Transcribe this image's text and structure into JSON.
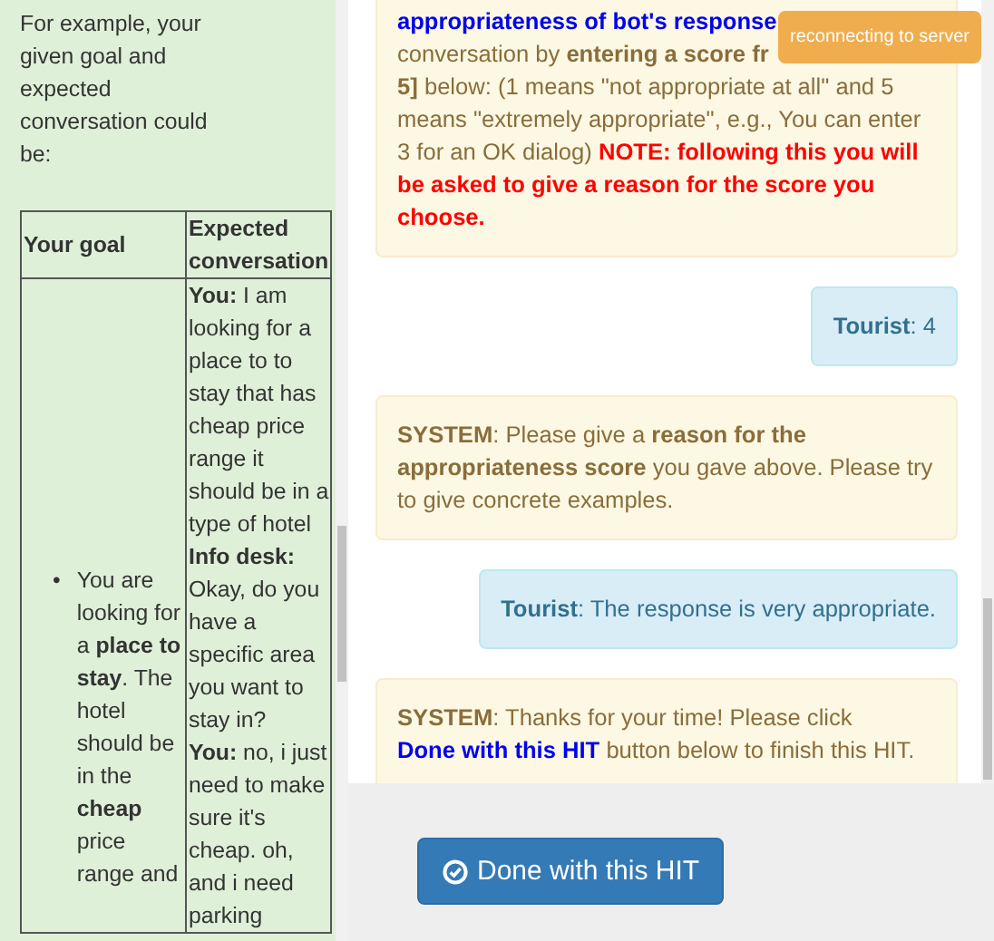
{
  "instructions": {
    "intro": "For example, your given goal and expected conversation could be:",
    "table": {
      "columns": [
        "Your goal",
        "Expected conversation"
      ],
      "bullet": "•",
      "goal": "You are looking for a **place to stay**. The hotel should be in the **cheap** price range and",
      "conversation": [
        "**You:** I am looking for a place to to stay that has cheap price range it should be in a type of hotel",
        "**Info desk:** Okay, do you have a specific area you want to stay in?",
        "**You:** no, i just need to make sure it's cheap. oh, and i need parking"
      ]
    }
  },
  "chat": {
    "messages": [
      {
        "kind": "instruction",
        "link": "appropriateness of bot's response",
        "text": "conversation by **entering a score fr** **5]** below: (1 means \"not appropriate at all\" and 5 means \"extremely appropriate\", e.g., You can enter 3 for an OK dialog)",
        "note": "NOTE: following this you will be asked to give a reason for the score you choose."
      },
      {
        "kind": "user",
        "text": "**Tourist**: 4"
      },
      {
        "kind": "system",
        "text": "**SYSTEM**: Please give a **reason for the appropriateness score** you gave above. Please try to give concrete examples."
      },
      {
        "kind": "user",
        "text": "**Tourist**: The response is very appropriate."
      },
      {
        "kind": "system",
        "text": "**SYSTEM**: Thanks for your time! Please click",
        "link": "Done with this HIT",
        "text_after": "button below to finish this HIT."
      }
    ]
  },
  "toast": {
    "text": "reconnecting to server"
  },
  "done_button": {
    "label": "Done with this HIT"
  }
}
